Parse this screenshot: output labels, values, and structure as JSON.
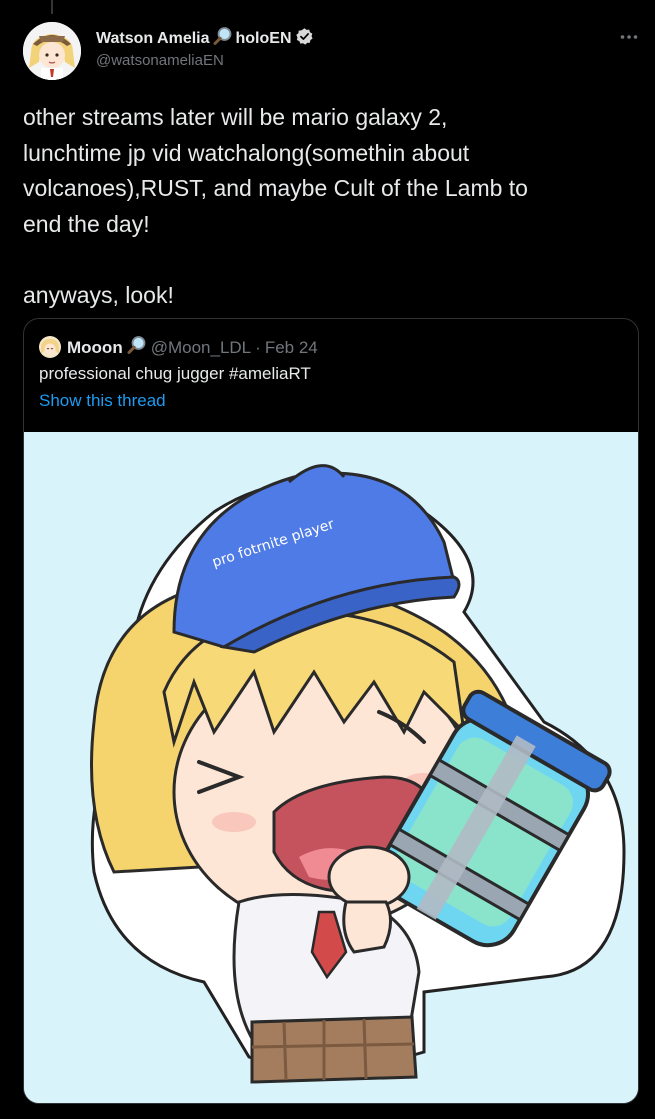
{
  "tweet": {
    "author": {
      "display_name": "Watson Amelia",
      "name_suffix": "holoEN",
      "handle": "@watsonameliaEN",
      "verified": true,
      "emoji_icon": "magnifying-glass-icon"
    },
    "more_icon": "more-options-icon",
    "text": "other streams later will be mario galaxy 2,\nlunchtime jp vid watchalong(somethin about\nvolcanoes),RUST, and maybe Cult of the Lamb to\nend the day!\n\nanyways, look!"
  },
  "quoted_tweet": {
    "display_name": "Mooon",
    "emoji_icon": "magnifying-glass-icon",
    "handle": "@Moon_LDL",
    "separator": "·",
    "date": "Feb 24",
    "text": "professional chug jugger #ameliaRT",
    "show_thread_label": "Show this thread",
    "media": {
      "cap_text": "pro fotrnite player",
      "background_color": "#d9f3fb"
    }
  },
  "colors": {
    "background": "#000000",
    "text_primary": "#e7e9ea",
    "text_secondary": "#71767b",
    "link": "#1d9bf0",
    "border": "#2f3336"
  }
}
